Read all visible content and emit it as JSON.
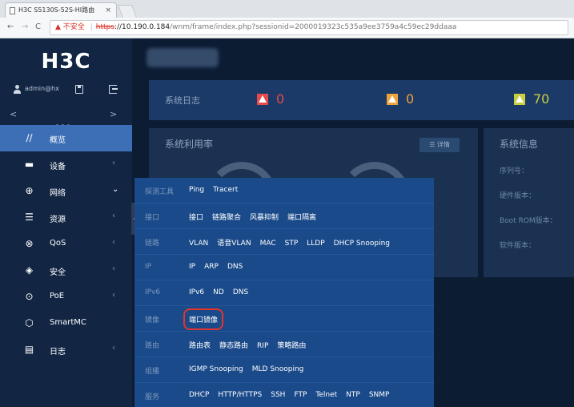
{
  "browser": {
    "tab_title": "H3C S5130S-52S-HI路由",
    "tab_close": "×",
    "nav_back": "←",
    "nav_forward": "→",
    "nav_reload": "C",
    "url_warning": "▲",
    "url_insecure": "不安全",
    "url_sep": "|",
    "url_scheme": "https",
    "url_host": "://10.190.0.184",
    "url_path": "/wnm/frame/index.php?sessionid=2000019323c535a9ee3759a4c59ec29ddaaa"
  },
  "sidebar": {
    "logo": "H3C",
    "username": "admin@hx",
    "pager_prev": "<",
    "pager_next": ">",
    "items": [
      {
        "label": "概览",
        "icon": "∕∕",
        "arrow": ""
      },
      {
        "label": "设备",
        "icon": "▬",
        "arrow": "‹"
      },
      {
        "label": "网络",
        "icon": "⊕",
        "arrow": "⌄"
      },
      {
        "label": "资源",
        "icon": "☰",
        "arrow": "‹"
      },
      {
        "label": "QoS",
        "icon": "⊗",
        "arrow": "‹"
      },
      {
        "label": "安全",
        "icon": "◈",
        "arrow": "‹"
      },
      {
        "label": "PoE",
        "icon": "⊙",
        "arrow": "‹"
      },
      {
        "label": "SmartMC",
        "icon": "⬡",
        "arrow": ""
      },
      {
        "label": "日志",
        "icon": "▤",
        "arrow": "‹"
      }
    ]
  },
  "dashboard": {
    "alarm_title": "系统日志",
    "alarms": [
      {
        "count": "0",
        "color": "#e8494b"
      },
      {
        "count": "0",
        "color": "#f0a23a"
      },
      {
        "count": "70",
        "color": "#c7cf3c"
      }
    ],
    "util_title": "系统利用率",
    "detail_label": "☰ 详情",
    "info_title": "系统信息",
    "info_rows": [
      "序列号：",
      "硬件版本：",
      "Boot ROM版本：",
      "软件版本："
    ]
  },
  "flyout": {
    "rows": [
      {
        "category": "探测工具",
        "items": [
          "Ping",
          "Tracert"
        ]
      },
      {
        "category": "接口",
        "items": [
          "接口",
          "链路聚合",
          "风暴抑制",
          "端口隔离"
        ]
      },
      {
        "category": "链路",
        "items": [
          "VLAN",
          "语音VLAN",
          "MAC",
          "STP",
          "LLDP",
          "DHCP Snooping"
        ]
      },
      {
        "category": "IP",
        "items": [
          "IP",
          "ARP",
          "DNS"
        ]
      },
      {
        "category": "IPv6",
        "items": [
          "IPv6",
          "ND",
          "DNS"
        ]
      },
      {
        "category": "镜像",
        "items": [
          "端口镜像"
        ]
      },
      {
        "category": "路由",
        "items": [
          "路由表",
          "静态路由",
          "RIP",
          "策略路由"
        ]
      },
      {
        "category": "组播",
        "items": [
          "IGMP Snooping",
          "MLD Snooping"
        ]
      },
      {
        "category": "服务",
        "items": [
          "DHCP",
          "HTTP/HTTPS",
          "SSH",
          "FTP",
          "Telnet",
          "NTP",
          "SNMP"
        ]
      }
    ],
    "highlight_item": "端口镜像"
  }
}
